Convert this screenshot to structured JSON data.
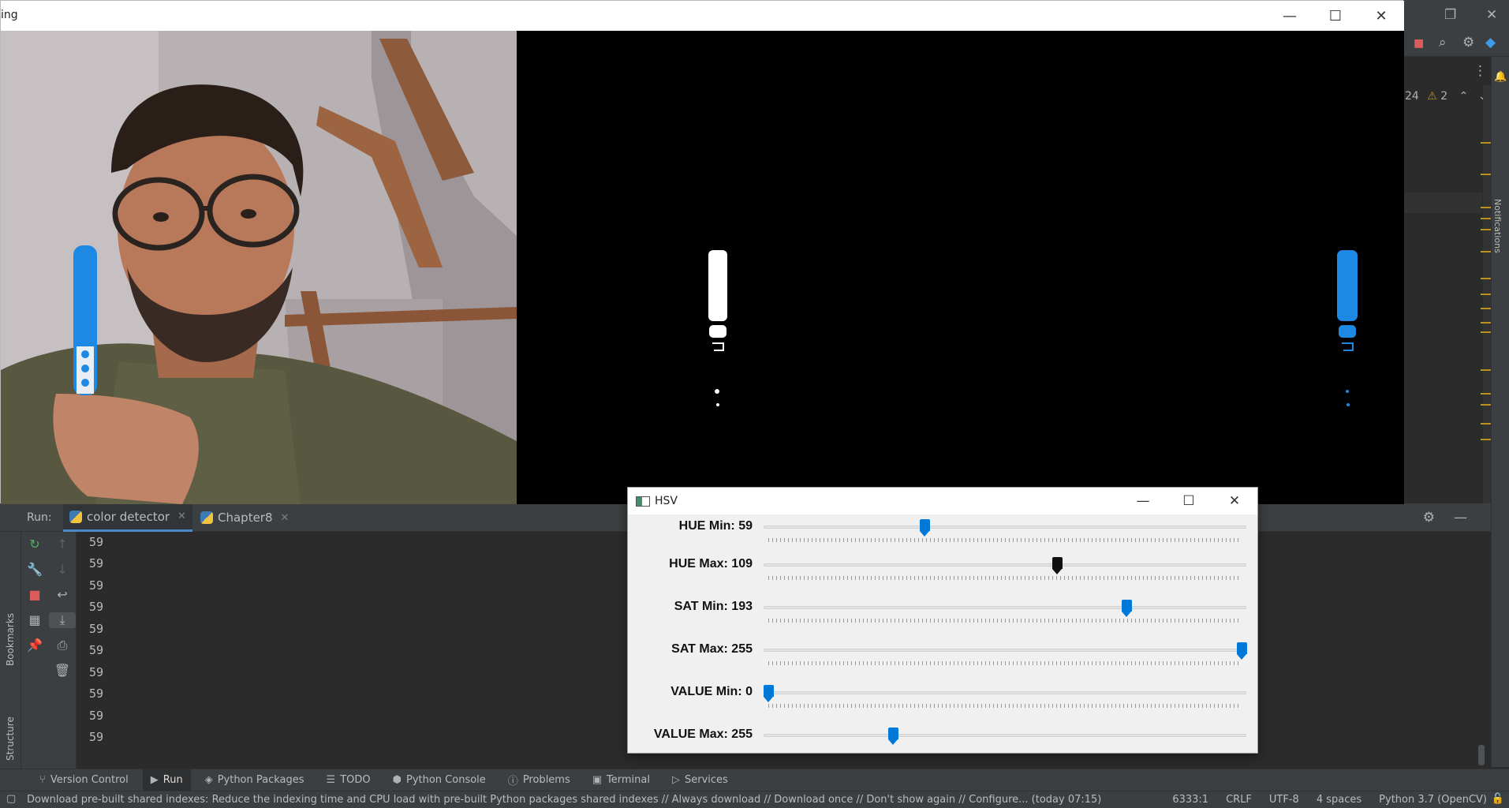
{
  "colors": {
    "accent": "#0078d7",
    "ide_bg": "#2b2b2b",
    "ide_panel": "#3c3f41",
    "warning_mark": "#be9117",
    "marker_blue": "#1e88e5"
  },
  "cv_window": {
    "title": "ing"
  },
  "hsv_window": {
    "title": "HSV",
    "trackbars": [
      {
        "label": "HUE Min: 59",
        "value": 59,
        "max": 179,
        "fraction": 0.33
      },
      {
        "label": "HUE Max: 109",
        "value": 109,
        "max": 179,
        "fraction": 0.61,
        "focused": true
      },
      {
        "label": "SAT Min: 193",
        "value": 193,
        "max": 255,
        "fraction": 0.757
      },
      {
        "label": "SAT Max: 255",
        "value": 255,
        "max": 255,
        "fraction": 1.0
      },
      {
        "label": "VALUE Min: 0",
        "value": 0,
        "max": 255,
        "fraction": 0.0
      },
      {
        "label": "VALUE Max: 255",
        "value": 255,
        "max": 255,
        "fraction": 0.264
      }
    ]
  },
  "ide": {
    "inspections": {
      "weak_count": "24",
      "warning_count": "2"
    },
    "side_tools": {
      "bookmarks": "Bookmarks",
      "structure": "Structure",
      "notifications": "Notifications"
    },
    "run": {
      "label": "Run:",
      "tabs": [
        {
          "label": "color detector",
          "active": true
        },
        {
          "label": "Chapter8",
          "active": false
        }
      ],
      "console_lines": [
        "59",
        "59",
        "59",
        "59",
        "59",
        "59",
        "59",
        "59",
        "59",
        "59"
      ]
    },
    "bottom_tabs": [
      {
        "label": "Version Control",
        "icon": "branch-icon"
      },
      {
        "label": "Run",
        "icon": "play-icon",
        "active": true
      },
      {
        "label": "Python Packages",
        "icon": "layers-icon"
      },
      {
        "label": "TODO",
        "icon": "list-icon"
      },
      {
        "label": "Python Console",
        "icon": "python-icon"
      },
      {
        "label": "Problems",
        "icon": "info-icon"
      },
      {
        "label": "Terminal",
        "icon": "terminal-icon"
      },
      {
        "label": "Services",
        "icon": "services-icon"
      }
    ],
    "status": {
      "message": "Download pre-built shared indexes: Reduce the indexing time and CPU load with pre-built Python packages shared indexes // Always download // Download once // Don't show again // Configure... (today 07:15)",
      "position": "6333:1",
      "line_sep": "CRLF",
      "encoding": "UTF-8",
      "indent": "4 spaces",
      "interpreter": "Python 3.7 (OpenCV)"
    }
  }
}
